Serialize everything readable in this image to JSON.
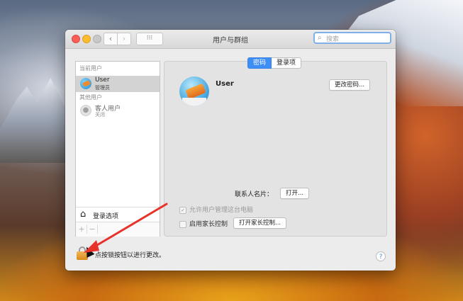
{
  "window": {
    "title": "用户与群组",
    "search_placeholder": "搜索",
    "nav_back": "‹",
    "nav_forward": "›",
    "grid": "⁝⁝⁝"
  },
  "sidebar": {
    "current_users_header": "当前用户",
    "current_user": {
      "name": "User",
      "role": "管理员"
    },
    "other_users_header": "其他用户",
    "guest_user": {
      "name": "客人用户",
      "status": "关闭"
    },
    "login_options": "登录选项",
    "add": "+",
    "remove": "−"
  },
  "tabs": {
    "password": "密码",
    "login_items": "登录项"
  },
  "panel": {
    "user_name": "User",
    "change_password_button": "更改密码...",
    "contact_card_label": "联系人名片：",
    "open_button": "打开...",
    "allow_admin_label": "允许用户管理这台电脑",
    "parental_controls_label": "启用家长控制",
    "open_parental_controls_button": "打开家长控制..."
  },
  "footer": {
    "lock_text": "点按锁按钮以进行更改。",
    "help": "?"
  },
  "colors": {
    "accent": "#3e8ef7",
    "annotation_arrow": "#e8312a"
  }
}
